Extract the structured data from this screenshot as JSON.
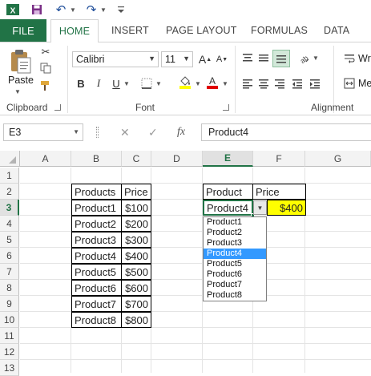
{
  "ribbon_tabs": {
    "file": "FILE",
    "home": "HOME",
    "insert": "INSERT",
    "page_layout": "PAGE LAYOUT",
    "formulas": "FORMULAS",
    "data": "DATA"
  },
  "clipboard": {
    "paste_label": "Paste",
    "group_label": "Clipboard"
  },
  "font": {
    "name": "Calibri",
    "size": "11",
    "bold": "B",
    "italic": "I",
    "underline": "U",
    "grow": "A",
    "shrink": "A",
    "font_color": "A",
    "group_label": "Font"
  },
  "alignment": {
    "wrap_label": "Wr",
    "merge_label": "Me",
    "group_label": "Alignment"
  },
  "formula_bar": {
    "name_box": "E3",
    "cancel": "✕",
    "enter": "✓",
    "fx": "fx",
    "value": "Product4"
  },
  "columns": [
    "A",
    "B",
    "C",
    "D",
    "E",
    "F",
    "G"
  ],
  "rows": [
    "1",
    "2",
    "3",
    "4",
    "5",
    "6",
    "7",
    "8",
    "9",
    "10",
    "11",
    "12",
    "13"
  ],
  "table": {
    "header_products": "Products",
    "header_price": "Price",
    "rows": [
      {
        "product": "Product1",
        "price": "$100"
      },
      {
        "product": "Product2",
        "price": "$200"
      },
      {
        "product": "Product3",
        "price": "$300"
      },
      {
        "product": "Product4",
        "price": "$400"
      },
      {
        "product": "Product5",
        "price": "$500"
      },
      {
        "product": "Product6",
        "price": "$600"
      },
      {
        "product": "Product7",
        "price": "$700"
      },
      {
        "product": "Product8",
        "price": "$800"
      }
    ]
  },
  "lookup": {
    "header_product": "Product",
    "header_price": "Price",
    "selected_product": "Product4",
    "result_price": "$400"
  },
  "dropdown_options": [
    "Product1",
    "Product2",
    "Product3",
    "Product4",
    "Product5",
    "Product6",
    "Product7",
    "Product8"
  ],
  "dropdown_selected_index": 3,
  "colors": {
    "accent": "#217346",
    "highlight_yellow": "#ffff00",
    "selection_blue": "#3399ff"
  }
}
